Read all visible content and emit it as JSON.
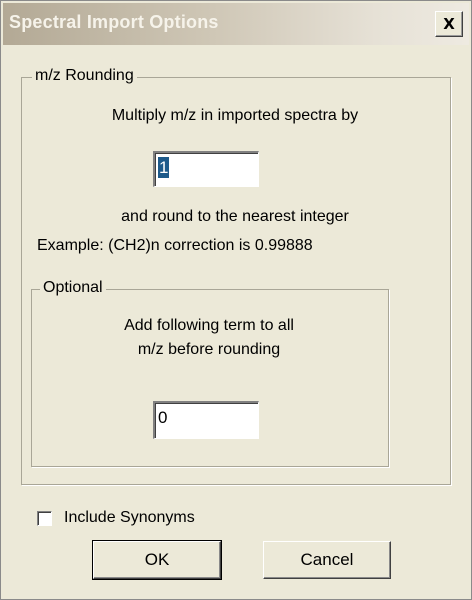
{
  "window": {
    "title": "Spectral Import Options",
    "close_label": "X"
  },
  "rounding_group": {
    "legend": "m/z Rounding",
    "instruction": "Multiply m/z in imported spectra by",
    "multiplier_value": "1",
    "round_text": "and round to the nearest integer",
    "example_text": "Example: (CH2)n correction is 0.99888"
  },
  "optional_group": {
    "legend": "Optional",
    "instruction_line1": "Add following term to all",
    "instruction_line2": "m/z before rounding",
    "term_value": "0"
  },
  "include_synonyms": {
    "label": "Include Synonyms",
    "checked": false
  },
  "buttons": {
    "ok_label": "OK",
    "cancel_label": "Cancel"
  }
}
